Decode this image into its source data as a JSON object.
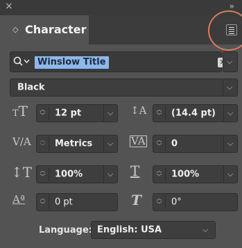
{
  "panel": {
    "title": "Character",
    "font_name": "Winslow Title",
    "font_style": "Black"
  },
  "controls": {
    "font_size": "12 pt",
    "leading": "(14.4 pt)",
    "kerning": "Metrics",
    "tracking": "0",
    "vertical_scale": "100%",
    "horizontal_scale": "100%",
    "baseline_shift": "0 pt",
    "rotation": "0°"
  },
  "language": {
    "label": "Language:",
    "value": "English: USA"
  },
  "colors": {
    "panel_bg": "#535353",
    "field_bg": "#3e3e3e",
    "selection": "#8eb8e8",
    "highlight_ring": "#e07a5f"
  }
}
